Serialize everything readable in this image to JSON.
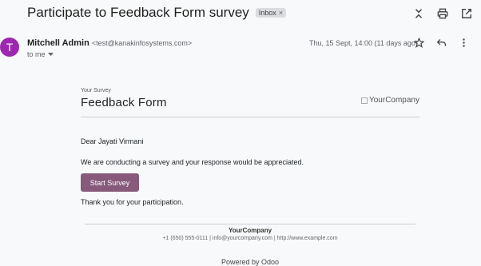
{
  "email": {
    "subject": "Participate to Feedback Form survey",
    "label": "Inbox",
    "label_remove": "×",
    "sender": {
      "avatar_letter": "T",
      "avatar_color": "#9c27b0",
      "name": "Mitchell Admin",
      "email": "<test@kanakinfosystems.com>",
      "recipient": "to me"
    },
    "date": "Thu, 15 Sept, 14:00 (11 days ago)",
    "top_actions": [
      "collapse-expand-icon",
      "print-icon",
      "open-in-new-window-icon"
    ],
    "message_actions": [
      "star-icon",
      "reply-icon",
      "more-vertical-icon"
    ]
  },
  "body": {
    "your_survey": "Your Survey",
    "form_title": "Feedback Form",
    "company_logo_alt": "YourCompany",
    "greeting": "Dear Jayati Virmani",
    "message": "We are conducting a survey and your response would be appreciated.",
    "start_button": "Start Survey",
    "start_button_color": "#875a7b",
    "thanks": "Thank you for your participation.",
    "footer_company": "YourCompany",
    "footer_contact": "+1 (650) 555-0111 | info@yourcompany.com | http://www.example.com",
    "powered_by": "Powered by Odoo"
  }
}
